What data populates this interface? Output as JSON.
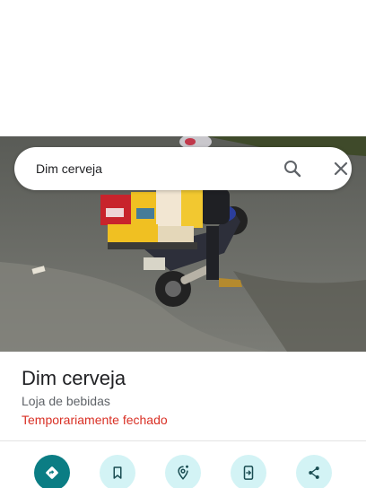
{
  "search": {
    "query": "Dim cerveja"
  },
  "place": {
    "name": "Dim cerveja",
    "category": "Loja de bebidas",
    "status": "Temporariamente fechado"
  },
  "photo": {
    "subject": "motorcycle-with-beer-crates"
  },
  "actions": [
    {
      "icon": "directions-icon"
    },
    {
      "icon": "bookmark-icon"
    },
    {
      "icon": "nearby-location-icon"
    },
    {
      "icon": "send-to-phone-icon"
    },
    {
      "icon": "share-icon"
    }
  ],
  "colors": {
    "primary_action": "#0b7d84",
    "action_bg": "#d3f3f5",
    "status_closed": "#d93025",
    "text_primary": "#202124",
    "text_secondary": "#5f6368"
  }
}
